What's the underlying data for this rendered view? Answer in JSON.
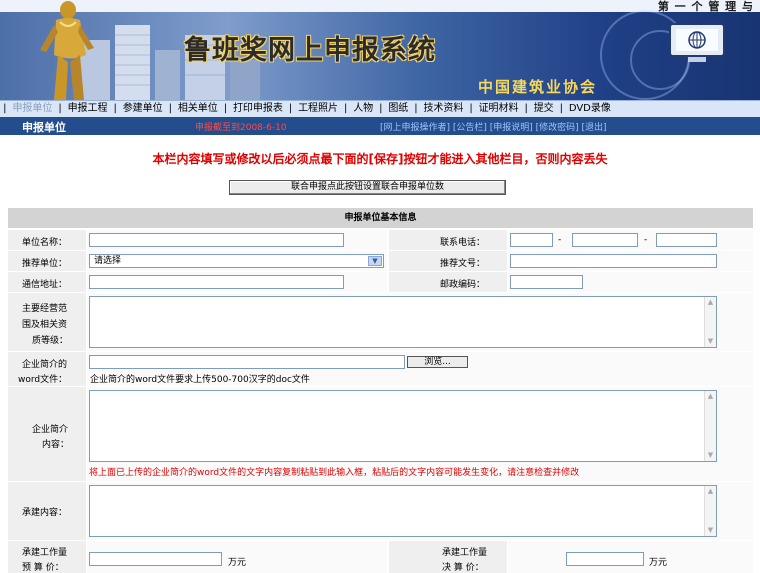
{
  "banner": {
    "top_text": "第 一 个 管 理 与 ",
    "title": "鲁班奖网上申报系统",
    "subtitle": "中国建筑业协会"
  },
  "nav": {
    "items": [
      {
        "label": "申报单位",
        "active": true
      },
      {
        "label": "申报工程",
        "active": false
      },
      {
        "label": "参建单位",
        "active": false
      },
      {
        "label": "相关单位",
        "active": false
      },
      {
        "label": "打印申报表",
        "active": false
      },
      {
        "label": "工程照片",
        "active": false
      },
      {
        "label": "人物",
        "active": false
      },
      {
        "label": "图纸",
        "active": false
      },
      {
        "label": "技术资料",
        "active": false
      },
      {
        "label": "证明材料",
        "active": false
      },
      {
        "label": "提交",
        "active": false
      },
      {
        "label": "DVD录像",
        "active": false
      }
    ]
  },
  "infobar": {
    "title": "申报单位",
    "deadline": "申报截至到2008-6-10",
    "links": "[网上申报操作者] [公告栏] [申报说明] [修改密码] [退出]"
  },
  "warning": "本栏内容填写或修改以后必须点最下面的[保存]按钮才能进入其他栏目，否则内容丢失",
  "combo_button": "联合申报点此按钮设置联合申报单位数",
  "form": {
    "section_title": "申报单位基本信息",
    "unit_name_label": "单位名称：",
    "phone_label": "联系电话：",
    "phone_sep": "-",
    "recommend_label": "推荐单位：",
    "recommend_value": "请选择",
    "recommend_doc_label": "推荐文号：",
    "address_label": "通信地址：",
    "postcode_label": "邮政编码：",
    "scope_label_1": "主要经营范",
    "scope_label_2": "围及相关资",
    "scope_label_3": "质等级：",
    "word_label_1": "企业简介的",
    "word_label_2": "word文件：",
    "browse_label": "浏览...",
    "word_hint": "企业简介的word文件要求上传500-700汉字的doc文件",
    "intro_label_1": "企业简介",
    "intro_label_2": "内容：",
    "intro_note": "将上面已上传的企业简介的word文件的文字内容复制粘贴到此输入框，粘贴后的文字内容可能发生变化，请注意检查并修改",
    "undertake_label": "承建内容：",
    "budget_label_1": "承建工作量",
    "budget_label_2": "预 算 价：",
    "budget_unit": "万元",
    "final_label_1": "承建工作量",
    "final_label_2": "决 算 价：",
    "final_unit": "万元"
  }
}
